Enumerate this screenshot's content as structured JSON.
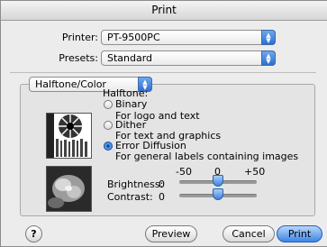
{
  "window": {
    "title": "Print"
  },
  "printer": {
    "label": "Printer:",
    "value": "PT-9500PC"
  },
  "presets": {
    "label": "Presets:",
    "value": "Standard"
  },
  "panel": {
    "value": "Halftone/Color"
  },
  "halftone": {
    "heading": "Halftone:",
    "options": [
      {
        "label": "Binary",
        "desc": "For logo and text",
        "selected": false
      },
      {
        "label": "Dither",
        "desc": "For text and graphics",
        "selected": false
      },
      {
        "label": "Error Diffusion",
        "desc": "For general labels containing images",
        "selected": true
      }
    ]
  },
  "scale": {
    "min": "-50",
    "mid": "0",
    "max": "+50"
  },
  "brightness": {
    "label": "Brightness:",
    "value": "0"
  },
  "contrast": {
    "label": "Contrast:",
    "value": "0"
  },
  "buttons": {
    "help": "?",
    "preview": "Preview",
    "cancel": "Cancel",
    "print": "Print"
  },
  "colors": {
    "accent": "#3d85e6"
  }
}
